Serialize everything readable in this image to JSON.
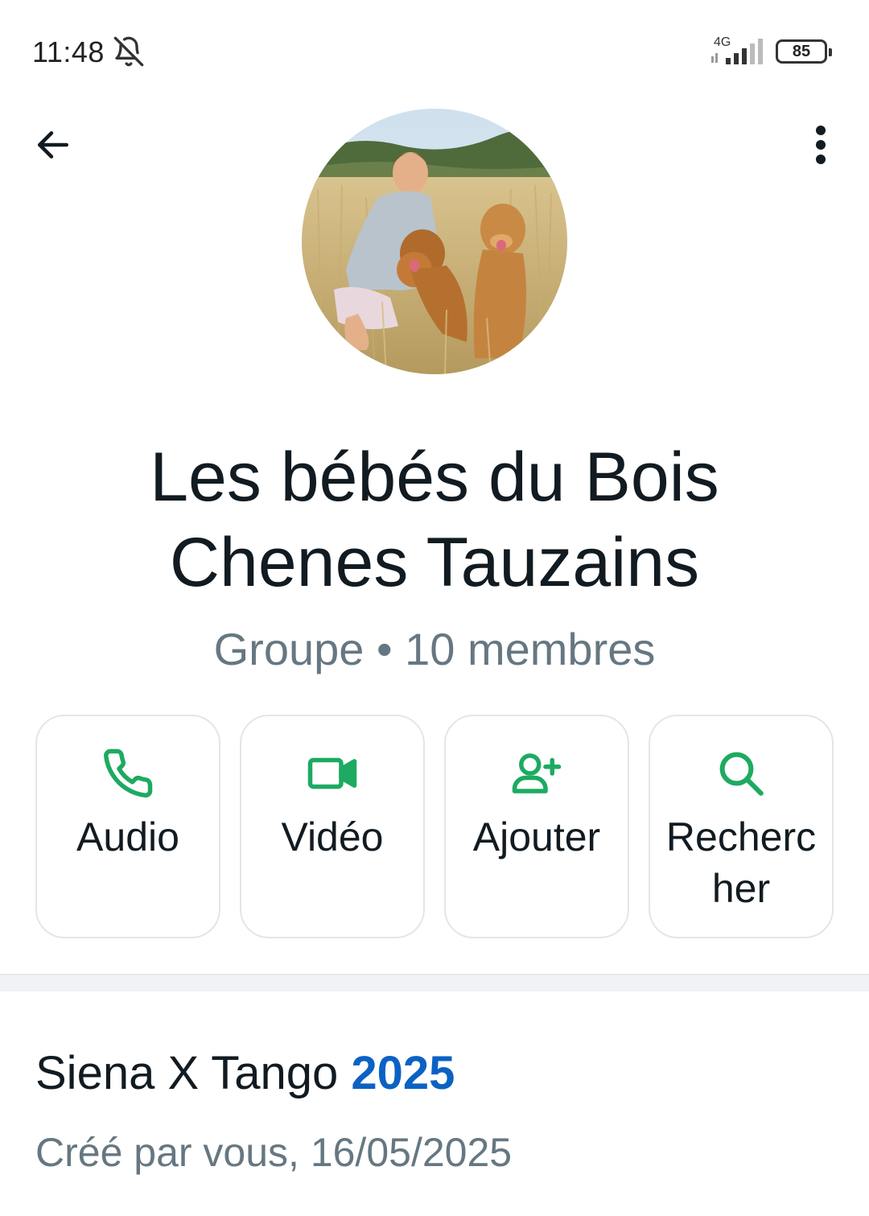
{
  "status_bar": {
    "time": "11:48",
    "network": "4G",
    "battery": "85",
    "icons": [
      "bell-off-icon",
      "signal-icon",
      "battery-icon"
    ]
  },
  "header": {
    "back_icon": "arrow-left-icon",
    "more_icon": "more-vertical-icon"
  },
  "group": {
    "name": "Les bébés du Bois Chenes Tauzains",
    "meta": "Groupe • 10 membres"
  },
  "actions": [
    {
      "label": "Audio",
      "icon": "phone-icon"
    },
    {
      "label": "Vidéo",
      "icon": "video-icon"
    },
    {
      "label": "Ajouter",
      "icon": "add-person-icon"
    },
    {
      "label": "Rechercher",
      "icon": "search-icon"
    }
  ],
  "description": {
    "title_prefix": "Siena X Tango ",
    "title_year": "2025",
    "created": "Créé par vous, 16/05/2025"
  },
  "colors": {
    "accent_green": "#1daa61",
    "link_blue": "#0b62c4",
    "secondary_text": "#667781"
  }
}
